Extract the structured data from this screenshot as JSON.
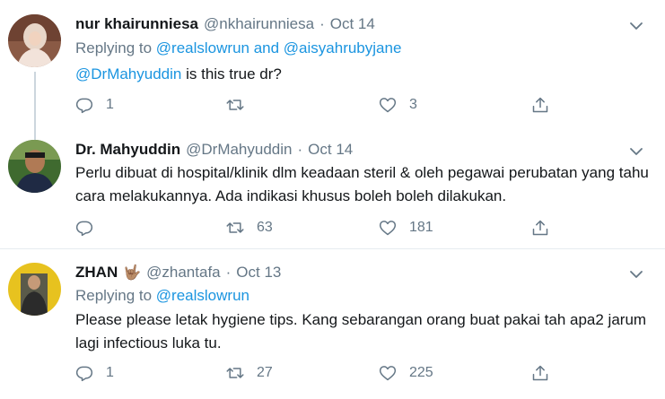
{
  "tweets": [
    {
      "name": "nur khairunniesa",
      "handle": "@nkhairunniesa",
      "date": "Oct 14",
      "replying_label": "Replying to",
      "replying_to": "@realslowrun and @aisyahrubyjane",
      "mention": "@DrMahyuddin",
      "text": " is this true dr?",
      "replies": "1",
      "retweets": "",
      "likes": "3"
    },
    {
      "name": "Dr. Mahyuddin",
      "handle": "@DrMahyuddin",
      "date": "Oct 14",
      "text": "Perlu dibuat di hospital/klinik dlm keadaan steril & oleh pegawai perubatan yang tahu cara melakukannya. Ada indikasi khusus boleh boleh dilakukan.",
      "replies": "",
      "retweets": "63",
      "likes": "181"
    },
    {
      "name": "ZHAN",
      "name_emoji": "🤟🏽",
      "handle": "@zhantafa",
      "date": "Oct 13",
      "replying_label": "Replying to",
      "replying_to": "@realslowrun",
      "text": "Please please letak hygiene tips. Kang sebarangan orang buat pakai tah apa2 jarum lagi infectious luka tu.",
      "replies": "1",
      "retweets": "27",
      "likes": "225"
    }
  ],
  "dot": "·",
  "colors": {
    "link": "#1b95e0",
    "muted": "#657786",
    "text": "#14171a",
    "border": "#e6ecf0"
  }
}
